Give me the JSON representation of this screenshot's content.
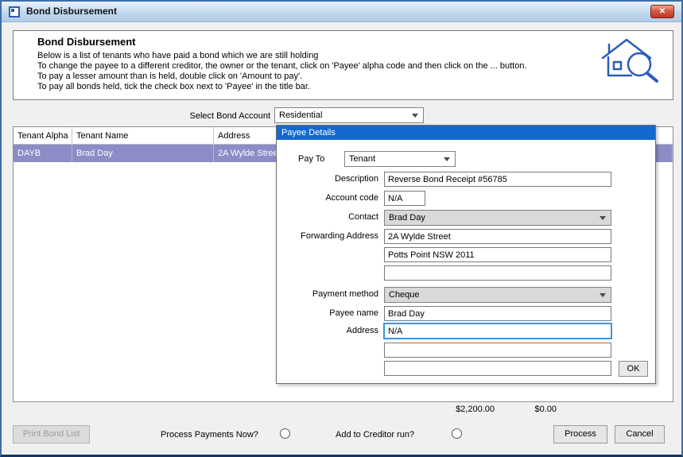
{
  "window": {
    "title": "Bond Disbursement",
    "close_glyph": "✕"
  },
  "header": {
    "title": "Bond Disbursement",
    "instructions": [
      "Below is a list of tenants who have paid a bond which we are still holding",
      "To change the payee to a different creditor, the owner or the tenant, click on 'Payee' alpha code and then click on the ... button.",
      "To pay a lesser amount than is held, double click on 'Amount to pay'.",
      "To pay all bonds held, tick the check box next to 'Payee' in the title bar."
    ]
  },
  "bond_account": {
    "label": "Select Bond Account",
    "value": "Residential"
  },
  "table": {
    "columns": [
      "Tenant Alpha",
      "Tenant Name",
      "Address"
    ],
    "rows": [
      {
        "tenant_alpha": "DAYB",
        "tenant_name": "Brad Day",
        "address": "2A Wylde Street"
      }
    ]
  },
  "payee_details": {
    "title": "Payee Details",
    "pay_to_label": "Pay To",
    "pay_to_value": "Tenant",
    "description_label": "Description",
    "description_value": "Reverse Bond Receipt #56785",
    "account_code_label": "Account code",
    "account_code_value": "N/A",
    "contact_label": "Contact",
    "contact_value": "Brad Day",
    "forwarding_address_label": "Forwarding Address",
    "forwarding_address_lines": [
      "2A Wylde Street",
      "Potts Point NSW 2011",
      ""
    ],
    "payment_method_label": "Payment method",
    "payment_method_value": "Cheque",
    "payee_name_label": "Payee name",
    "payee_name_value": "Brad Day",
    "address_label": "Address",
    "address_lines": [
      "N/A",
      "",
      ""
    ],
    "ok_label": "OK"
  },
  "totals": {
    "amount_held": "$2,200.00",
    "amount_to_pay": "$0.00"
  },
  "footer": {
    "print_button": "Print Bond List",
    "process_payments_label": "Process Payments Now?",
    "creditor_run_label": "Add to Creditor run?",
    "process_button": "Process",
    "cancel_button": "Cancel"
  },
  "colors": {
    "window_border": "#3c6ea8",
    "popup_titlebar": "#1468d0",
    "selection_row": "#8c8cc7",
    "focus_border": "#3a96dd",
    "close_button": "#c9402f"
  }
}
